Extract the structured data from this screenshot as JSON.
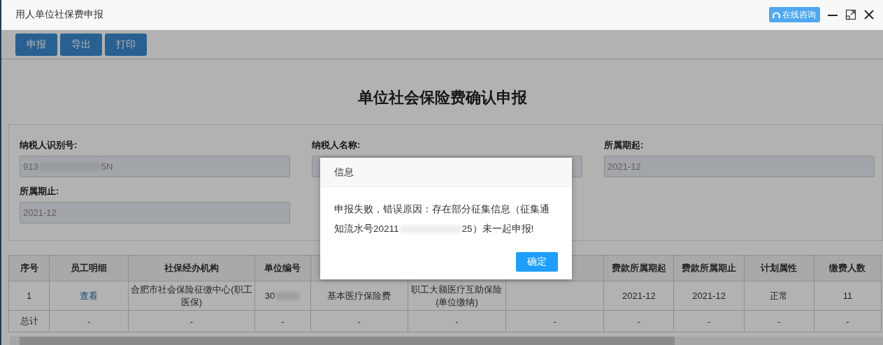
{
  "window": {
    "title": "用人单位社保费申报",
    "consult_button": "在线咨询"
  },
  "toolbar": [
    "申报",
    "导出",
    "打印"
  ],
  "heading": "单位社会保险费确认申报",
  "form": [
    {
      "label": "纳税人识别号:",
      "value": [
        "913",
        "5N"
      ]
    },
    {
      "label": "纳税人名称:"
    },
    {
      "label": "所属期起:",
      "value": [
        "2021-12"
      ]
    },
    {
      "label": "所属期止:",
      "value": [
        "2021-12"
      ]
    }
  ],
  "table": {
    "columns": [
      "序号",
      "员工明细",
      "社保经办机构",
      "单位编号",
      "",
      "",
      "",
      "费款所属期起",
      "费款所属期止",
      "计划属性",
      "缴费人数"
    ],
    "rows": [
      {
        "kind": "data",
        "cells": [
          "1",
          "查看",
          "合肥市社会保险征缴中心(职工医保)",
          "30",
          "基本医疗保险费",
          "职工大额医疗互助保险(单位缴纳)",
          "",
          "2021-12",
          "2021-12",
          "正常",
          "11"
        ]
      },
      {
        "kind": "total",
        "cells": [
          "总计",
          "-",
          "-",
          "-",
          "-",
          "-",
          "-",
          "-",
          "-",
          "-",
          "-"
        ]
      }
    ]
  },
  "dialog": {
    "title": "信息",
    "message": [
      "申报失败，错误原因：存在部分征集信息（征集通知流水号20211",
      "25）未一起申报!"
    ],
    "ok_button": "确定"
  }
}
